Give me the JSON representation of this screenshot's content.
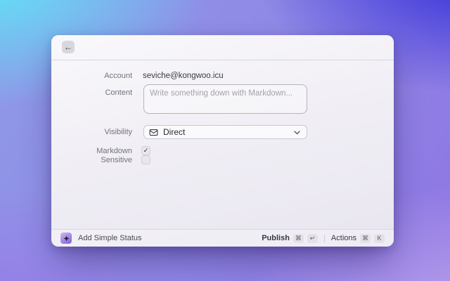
{
  "window": {
    "header": {
      "back_glyph": "←"
    },
    "form": {
      "account_label": "Account",
      "account_value": "seviche@kongwoo.icu",
      "content_label": "Content",
      "content_placeholder": "Write something down with Markdown...",
      "visibility_label": "Visibility",
      "visibility_value": "Direct",
      "markdown_label": "Markdown",
      "markdown_check_glyph": "✓",
      "sensitive_label": "Sensitive"
    },
    "footer": {
      "app_name": "Add Simple Status",
      "publish_label": "Publish",
      "publish_keys": [
        "⌘",
        "↵"
      ],
      "actions_label": "Actions",
      "actions_keys": [
        "⌘",
        "K"
      ]
    }
  },
  "colors": {
    "accent_purple": "#8b6ce0",
    "bg_top_left": "#5fe6f8",
    "bg_top_right": "#3330d8",
    "bg_bottom_left": "#987ae6",
    "bg_bottom_right": "#bba4ec",
    "window_bg": "#f1eff5"
  }
}
